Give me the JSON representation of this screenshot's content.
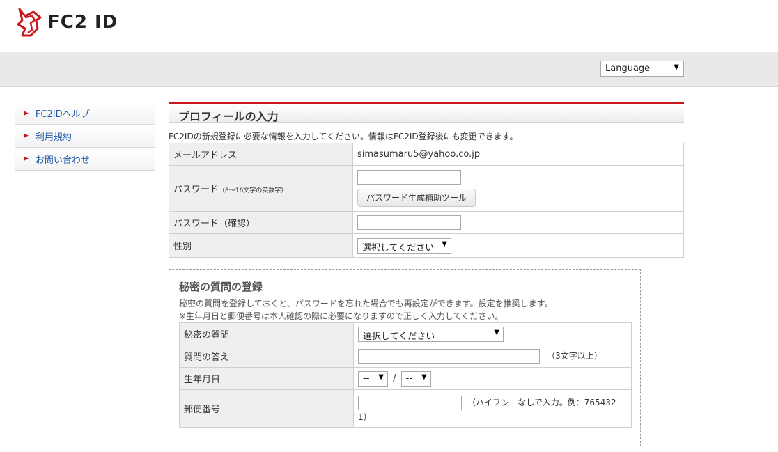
{
  "brand": {
    "name": "FC2 ID",
    "accent": "#c8161d"
  },
  "language": {
    "label": "Language"
  },
  "sidebar": {
    "items": [
      {
        "label": "FC2IDヘルプ"
      },
      {
        "label": "利用規約"
      },
      {
        "label": "お問い合わせ"
      }
    ]
  },
  "profile": {
    "title": "プロフィールの入力",
    "intro": "FC2IDの新規登録に必要な情報を入力してください。情報はFC2ID登録後にも変更できます。",
    "email_label": "メールアドレス",
    "email_value": "simasumaru5@yahoo.co.jp",
    "password_label": "パスワード",
    "password_note": "（8～16文字の英数字）",
    "password_tool": "パスワード生成補助ツール",
    "password_confirm_label": "パスワード（確認）",
    "gender_label": "性別",
    "gender_value": "選択してください"
  },
  "secret": {
    "title": "秘密の質問の登録",
    "note1": "秘密の質問を登録しておくと、パスワードを忘れた場合でも再設定ができます。設定を推奨します。",
    "note2": "※生年月日と郵便番号は本人確認の際に必要になりますので正しく入力してください。",
    "question_label": "秘密の質問",
    "question_value": "選択してください",
    "answer_label": "質問の答え",
    "answer_hint": "（3文字以上）",
    "birth_label": "生年月日",
    "birth_month": "--",
    "birth_sep": "/",
    "birth_day": "--",
    "zip_label": "郵便番号",
    "zip_hint_line1": "（ハイフン - なしで入力。例：765432",
    "zip_hint_line2": "1）"
  }
}
